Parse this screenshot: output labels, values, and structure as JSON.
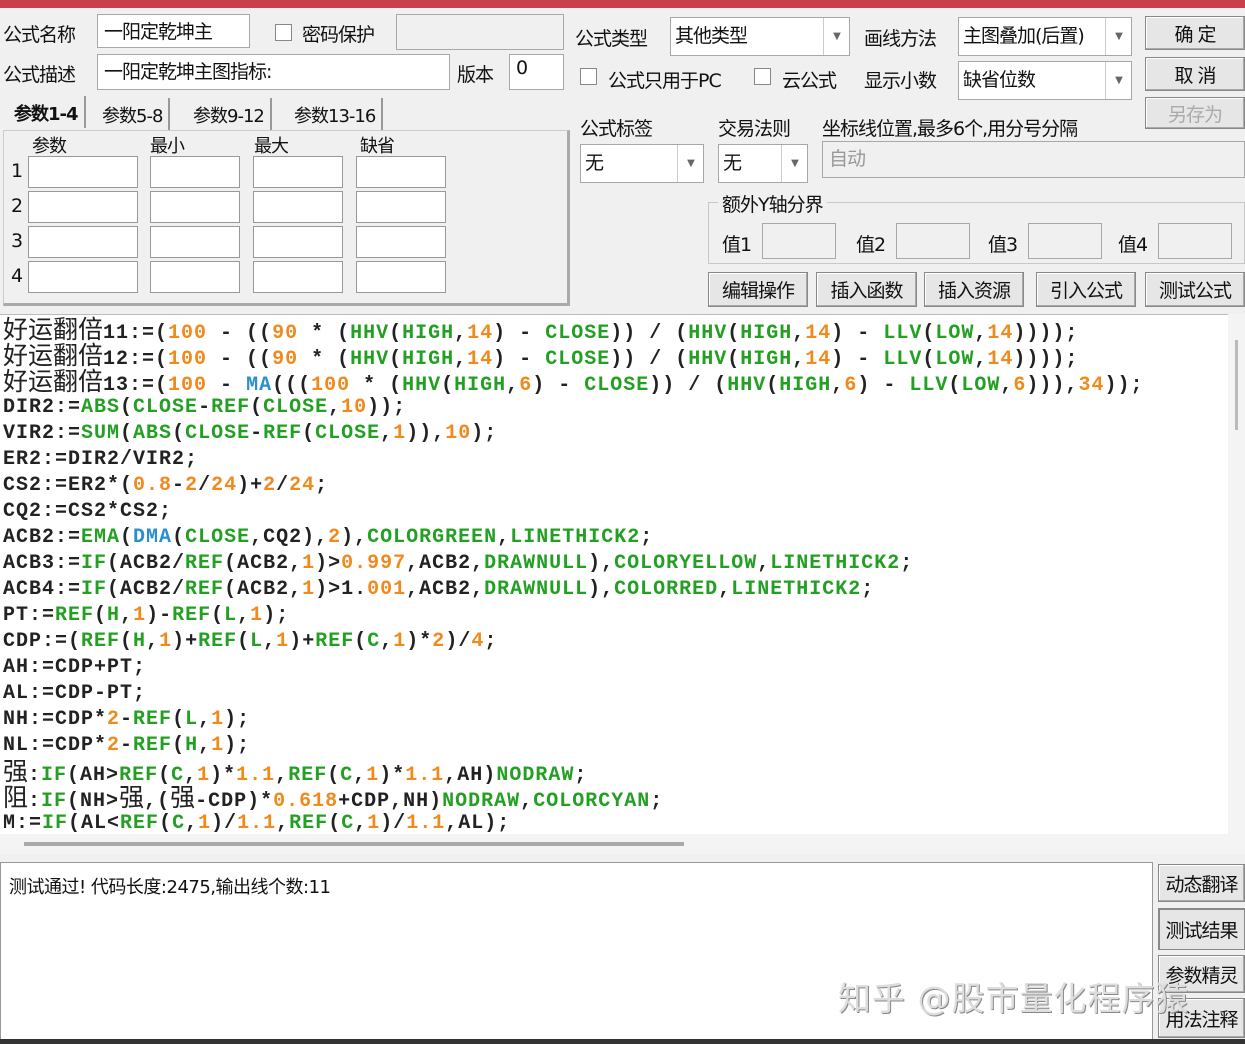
{
  "form": {
    "name_label": "公式名称",
    "name_value": "一阳定乾坤主",
    "password_label": "密码保护",
    "desc_label": "公式描述",
    "desc_value": "一阳定乾坤主图指标:",
    "version_label": "版本",
    "version_value": "0",
    "type_label": "公式类型",
    "type_value": "其他类型",
    "draw_label": "画线方法",
    "draw_value": "主图叠加(后置)",
    "pc_only_label": "公式只用于PC",
    "cloud_label": "云公式",
    "decimal_label": "显示小数",
    "decimal_value": "缺省位数",
    "tag_label": "公式标签",
    "tag_value": "无",
    "rule_label": "交易法则",
    "rule_value": "无",
    "axis_label": "坐标线位置,最多6个,用分号分隔",
    "axis_placeholder": "自动",
    "yaxis_group": "额外Y轴分界",
    "y_values": [
      "值1",
      "值2",
      "值3",
      "值4"
    ]
  },
  "buttons": {
    "ok": "确  定",
    "cancel": "取  消",
    "save_as": "另存为",
    "edit": "编辑操作",
    "insert_func": "插入函数",
    "insert_res": "插入资源",
    "import": "引入公式",
    "test": "测试公式",
    "dyn_translate": "动态翻译",
    "test_result": "测试结果",
    "param_wizard": "参数精灵",
    "usage_notes": "用法注释"
  },
  "params": {
    "tabs": [
      "参数1-4",
      "参数5-8",
      "参数9-12",
      "参数13-16"
    ],
    "headers": [
      "参数",
      "最小",
      "最大",
      "缺省"
    ],
    "rows": [
      "1",
      "2",
      "3",
      "4"
    ]
  },
  "code_lines": [
    "好运翻倍11:=([o:100] - (([o:90] * ([g:HHV]([g:HIGH],[o:14]) - [g:CLOSE])) / ([g:HHV]([g:HIGH],[o:14]) - [g:LLV]([g:LOW],[o:14]))));",
    "好运翻倍12:=([o:100] - (([o:90] * ([g:HHV]([g:HIGH],[o:14]) - [g:CLOSE])) / ([g:HHV]([g:HIGH],[o:14]) - [g:LLV]([g:LOW],[o:14]))));",
    "好运翻倍13:=([o:100] - [b:MA]((([o:100] * ([g:HHV]([g:HIGH],[o:6]) - [g:CLOSE])) / ([g:HHV]([g:HIGH],[o:6]) - [g:LLV]([g:LOW],[o:6]))),[o:34]));",
    "DIR2:=[g:ABS]([g:CLOSE]-[g:REF]([g:CLOSE],[o:10]));",
    "VIR2:=[g:SUM]([g:ABS]([g:CLOSE]-[g:REF]([g:CLOSE],[o:1])),[o:10]);",
    "ER2:=DIR2/VIR2;",
    "CS2:=ER2*([o:0.8]-[o:2]/[o:24])+[o:2]/[o:24];",
    "CQ2:=CS2*CS2;",
    "ACB2:=[g:EMA]([b:DMA]([g:CLOSE],CQ2),[o:2]),[g:COLORGREEN],[g:LINETHICK2];",
    "ACB3:=[g:IF](ACB2/[g:REF](ACB2,[o:1])>[o:0.997],ACB2,[g:DRAWNULL]),[g:COLORYELLOW],[g:LINETHICK2];",
    "ACB4:=[g:IF](ACB2/[g:REF](ACB2,[o:1])>1.[o:001],ACB2,[g:DRAWNULL]),[g:COLORRED],[g:LINETHICK2];",
    "PT:=[g:REF]([g:H],[o:1])-[g:REF]([g:L],[o:1]);",
    "CDP:=([g:REF]([g:H],[o:1])+[g:REF]([g:L],[o:1])+[g:REF]([g:C],[o:1])*[o:2])/[o:4];",
    "AH:=CDP+PT;",
    "AL:=CDP-PT;",
    "NH:=CDP*[o:2]-[g:REF]([g:L],[o:1]);",
    "NL:=CDP*[o:2]-[g:REF]([g:H],[o:1]);",
    "强:[g:IF](AH>[g:REF]([g:C],[o:1])*[o:1.1],[g:REF]([g:C],[o:1])*[o:1.1],AH)[g:NODRAW];",
    "阻:[g:IF](NH>强,(强-CDP)*[o:0.618]+CDP,NH)[g:NODRAW],[g:COLORCYAN];",
    "M:=[g:IF](AL<[g:REF]([g:C],[o:1])/[o:1.1],[g:REF]([g:C],[o:1])/[o:1.1],AL);"
  ],
  "output": {
    "message": "测试通过! 代码长度:2475,输出线个数:11"
  },
  "watermark": "知乎 @股市量化程序猿",
  "colors": {
    "function": "#23a023",
    "number": "#f08a1c",
    "builtin": "#2a8fd0",
    "titlebar": "#c9404a"
  }
}
